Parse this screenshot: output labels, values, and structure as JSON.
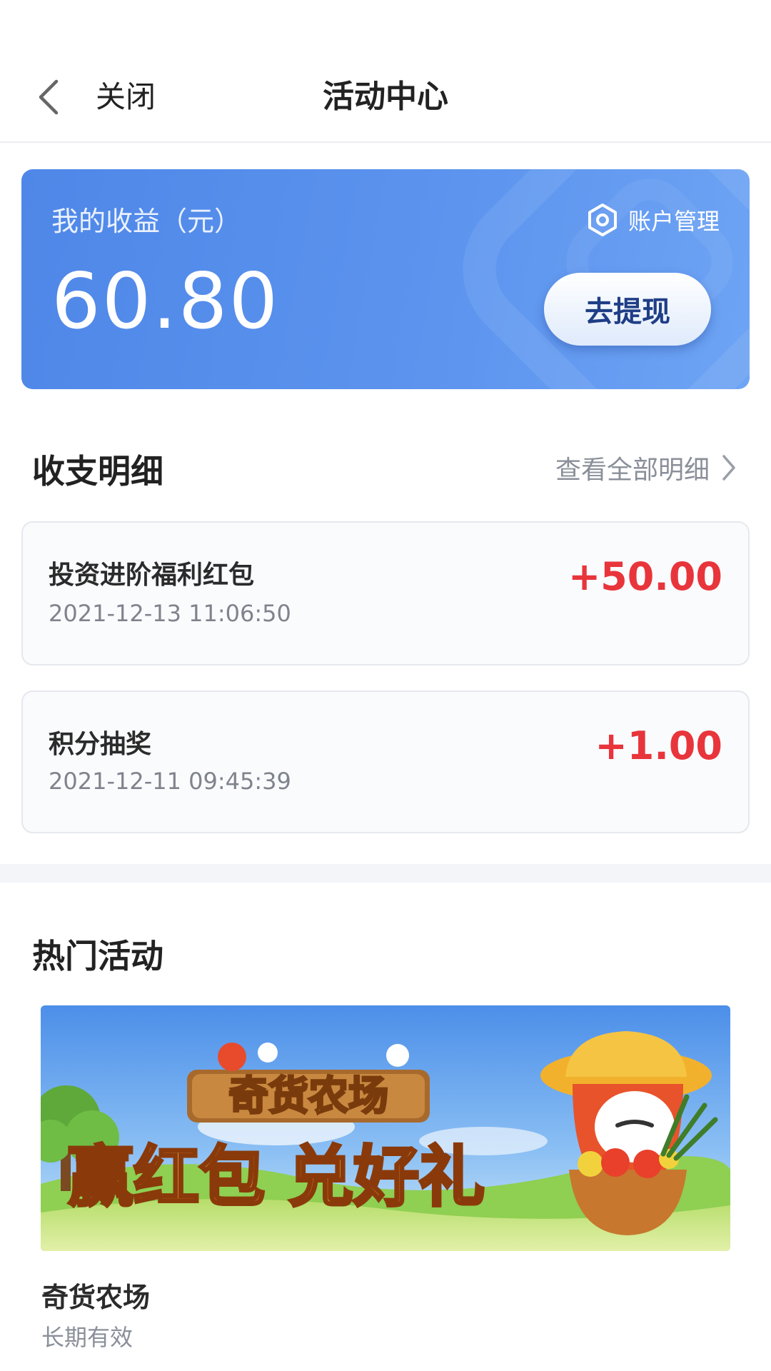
{
  "navbar": {
    "close_label": "关闭",
    "title": "活动中心"
  },
  "earnings": {
    "label": "我的收益（元）",
    "amount": "60.80",
    "account_management": "账户管理",
    "withdraw_label": "去提现"
  },
  "details": {
    "title": "收支明细",
    "view_all": "查看全部明细",
    "items": [
      {
        "name": "投资进阶福利红包",
        "time": "2021-12-13 11:06:50",
        "amount": "+50.00"
      },
      {
        "name": "积分抽奖",
        "time": "2021-12-11 09:45:39",
        "amount": "+1.00"
      }
    ]
  },
  "hot": {
    "title": "热门活动",
    "banner": {
      "logo_text": "奇货农场",
      "slogan": "赢红包 兑好礼"
    },
    "activity_name": "奇货农场",
    "activity_validity": "长期有效"
  },
  "colors": {
    "card_blue": "#5b93ee",
    "amount_red": "#e8353b",
    "banner_sky": "#5a9cf0",
    "banner_grass": "#9fd45a"
  },
  "icons": [
    "back-chevron-icon",
    "hexagon-settings-icon",
    "chevron-right-icon"
  ]
}
